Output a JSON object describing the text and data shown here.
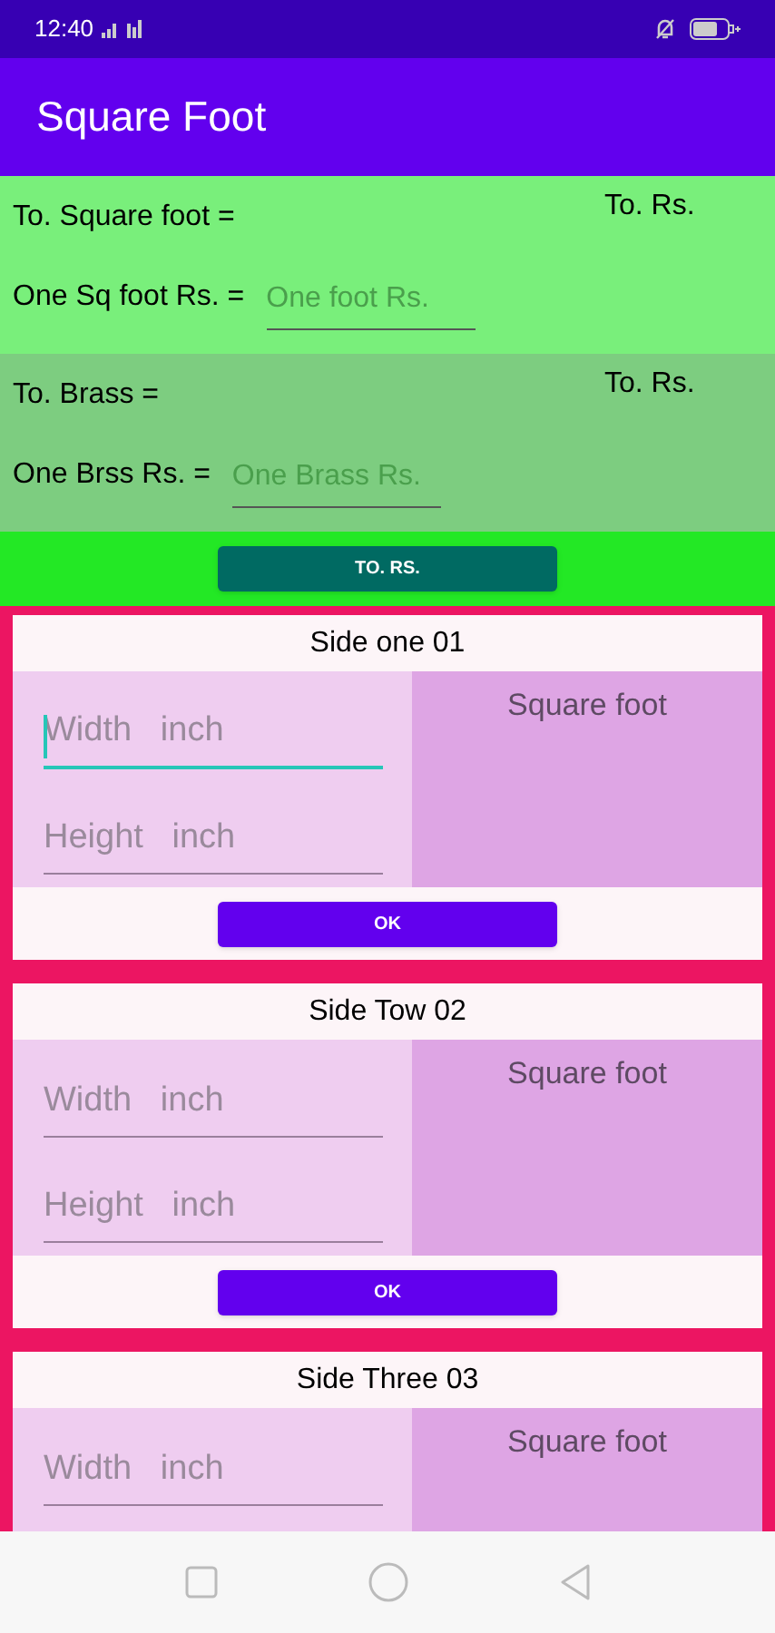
{
  "status_bar": {
    "time": "12:40"
  },
  "app_bar": {
    "title": "Square Foot"
  },
  "sections": [
    {
      "total_label": "To. Square foot  =",
      "total_rs_label": "To. Rs.",
      "rate_label": "One Sq foot Rs. =",
      "rate_placeholder": "One foot Rs."
    },
    {
      "total_label": "To. Brass  =",
      "total_rs_label": "To. Rs.",
      "rate_label": "One Brss Rs. =",
      "rate_placeholder": "One Brass Rs."
    }
  ],
  "total_button": "TO. RS.",
  "cards": [
    {
      "title": "Side one 01",
      "fields": [
        {
          "placeholder": "Width   inch",
          "focused": true
        },
        {
          "placeholder": "Height   inch",
          "focused": false
        }
      ],
      "result_label": "Square foot",
      "button": "OK"
    },
    {
      "title": "Side Tow 02",
      "fields": [
        {
          "placeholder": "Width   inch",
          "focused": false
        },
        {
          "placeholder": "Height   inch",
          "focused": false
        }
      ],
      "result_label": "Square foot",
      "button": "OK"
    },
    {
      "title": "Side Three 03",
      "fields": [
        {
          "placeholder": "Width   inch",
          "focused": false
        }
      ],
      "result_label": "Square foot"
    }
  ]
}
